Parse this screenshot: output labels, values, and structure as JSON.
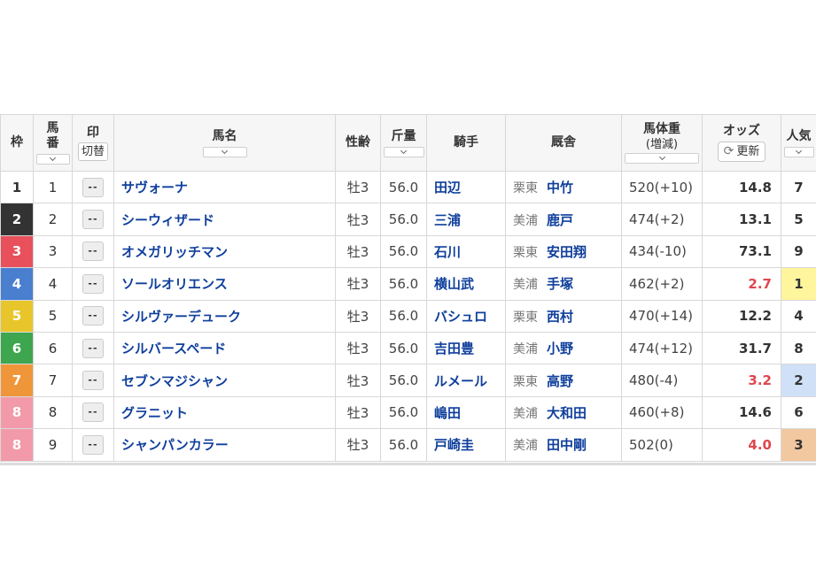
{
  "headers": {
    "waku": "枠",
    "umaban": [
      "馬",
      "番"
    ],
    "mark": "印",
    "mark_toggle": "切替",
    "name": "馬名",
    "sex_age": "性齢",
    "kinryo": "斤量",
    "jockey": "騎手",
    "stable": "厩舎",
    "weight": "馬体重",
    "weight_sub": "(増減)",
    "odds": "オッズ",
    "update": "更新",
    "ninki": "人気"
  },
  "rows": [
    {
      "waku": "1",
      "umaban": "1",
      "mark": "--",
      "name": "サヴォーナ",
      "sex_age": "牡3",
      "kinryo": "56.0",
      "jockey": "田辺",
      "region": "栗東",
      "trainer": "中竹",
      "weight": "520(+10)",
      "odds": "14.8",
      "ninki": "7"
    },
    {
      "waku": "2",
      "umaban": "2",
      "mark": "--",
      "name": "シーウィザード",
      "sex_age": "牡3",
      "kinryo": "56.0",
      "jockey": "三浦",
      "region": "美浦",
      "trainer": "鹿戸",
      "weight": "474(+2)",
      "odds": "13.1",
      "ninki": "5"
    },
    {
      "waku": "3",
      "umaban": "3",
      "mark": "--",
      "name": "オメガリッチマン",
      "sex_age": "牡3",
      "kinryo": "56.0",
      "jockey": "石川",
      "region": "栗東",
      "trainer": "安田翔",
      "weight": "434(-10)",
      "odds": "73.1",
      "ninki": "9"
    },
    {
      "waku": "4",
      "umaban": "4",
      "mark": "--",
      "name": "ソールオリエンス",
      "sex_age": "牡3",
      "kinryo": "56.0",
      "jockey": "横山武",
      "region": "美浦",
      "trainer": "手塚",
      "weight": "462(+2)",
      "odds": "2.7",
      "ninki": "1"
    },
    {
      "waku": "5",
      "umaban": "5",
      "mark": "--",
      "name": "シルヴァーデューク",
      "sex_age": "牡3",
      "kinryo": "56.0",
      "jockey": "バシュロ",
      "region": "栗東",
      "trainer": "西村",
      "weight": "470(+14)",
      "odds": "12.2",
      "ninki": "4"
    },
    {
      "waku": "6",
      "umaban": "6",
      "mark": "--",
      "name": "シルバースペード",
      "sex_age": "牡3",
      "kinryo": "56.0",
      "jockey": "吉田豊",
      "region": "美浦",
      "trainer": "小野",
      "weight": "474(+12)",
      "odds": "31.7",
      "ninki": "8"
    },
    {
      "waku": "7",
      "umaban": "7",
      "mark": "--",
      "name": "セブンマジシャン",
      "sex_age": "牡3",
      "kinryo": "56.0",
      "jockey": "ルメール",
      "region": "栗東",
      "trainer": "高野",
      "weight": "480(-4)",
      "odds": "3.2",
      "ninki": "2"
    },
    {
      "waku": "8",
      "umaban": "8",
      "mark": "--",
      "name": "グラニット",
      "sex_age": "牡3",
      "kinryo": "56.0",
      "jockey": "嶋田",
      "region": "美浦",
      "trainer": "大和田",
      "weight": "460(+8)",
      "odds": "14.6",
      "ninki": "6"
    },
    {
      "waku": "8",
      "umaban": "9",
      "mark": "--",
      "name": "シャンパンカラー",
      "sex_age": "牡3",
      "kinryo": "56.0",
      "jockey": "戸崎圭",
      "region": "美浦",
      "trainer": "田中剛",
      "weight": "502(0)",
      "odds": "4.0",
      "ninki": "3"
    }
  ],
  "colors": {
    "waku": {
      "1": {
        "bg": "#ffffff",
        "fg": "#333333"
      },
      "2": {
        "bg": "#333333",
        "fg": "#ffffff"
      },
      "3": {
        "bg": "#e8505b",
        "fg": "#ffffff"
      },
      "4": {
        "bg": "#4a7fd0",
        "fg": "#ffffff"
      },
      "5": {
        "bg": "#e8c62b",
        "fg": "#ffffff"
      },
      "6": {
        "bg": "#3ea64f",
        "fg": "#ffffff"
      },
      "7": {
        "bg": "#f0963a",
        "fg": "#ffffff"
      },
      "8": {
        "bg": "#f29aa9",
        "fg": "#ffffff"
      }
    },
    "popularity_highlight": {
      "1": "#fff59d",
      "2": "#cfe0f7",
      "3": "#f2c8a0"
    },
    "odds_hot": "#e0464e",
    "link": "#0f3f9c"
  },
  "hot_odds_rows": [
    4,
    7,
    9
  ]
}
